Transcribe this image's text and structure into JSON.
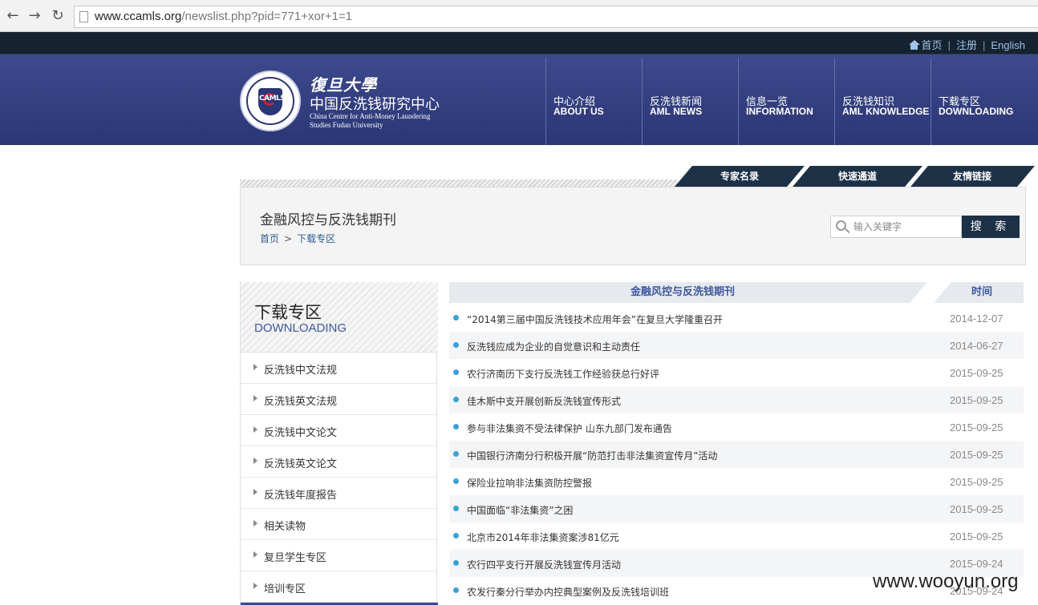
{
  "browser": {
    "url_host": "www.ccamls.org",
    "url_path": "/newslist.php?pid=771+xor+1=1"
  },
  "top_links": {
    "home": "首页",
    "register": "注册",
    "english": "English"
  },
  "brand": {
    "logo_text": "CAMLS",
    "script_title": "復旦大學",
    "name_cn": "中国反洗钱研究中心",
    "name_en_line1": "China Centre for Anti-Money Laundering",
    "name_en_line2": "Studies Fudan University"
  },
  "nav": [
    {
      "cn": "中心介绍",
      "en": "ABOUT US"
    },
    {
      "cn": "反洗钱新闻",
      "en": "AML NEWS"
    },
    {
      "cn": "信息一览",
      "en": "INFORMATION"
    },
    {
      "cn": "反洗钱知识",
      "en": "AML KNOWLEDGE"
    },
    {
      "cn": "下载专区",
      "en": "DOWNLOADING"
    }
  ],
  "tabs": [
    "专家名录",
    "快速通道",
    "友情链接"
  ],
  "page": {
    "title": "金融风控与反洗钱期刊",
    "crumb_home": "首页",
    "crumb_sep": ">",
    "crumb_current": "下载专区"
  },
  "search": {
    "placeholder": "输入关键字",
    "button": "搜 索"
  },
  "sidebar": {
    "title_cn": "下载专区",
    "title_en": "DOWNLOADING",
    "items": [
      "反洗钱中文法规",
      "反洗钱英文法规",
      "反洗钱中文论文",
      "反洗钱英文论文",
      "反洗钱年度报告",
      "相关读物",
      "复旦学生专区",
      "培训专区"
    ]
  },
  "list": {
    "col_title": "金融风控与反洗钱期刊",
    "col_time": "时间",
    "rows": [
      {
        "title": "“2014第三届中国反洗钱技术应用年会”在复旦大学隆重召开",
        "date": "2014-12-07"
      },
      {
        "title": "反洗钱应成为企业的自觉意识和主动责任",
        "date": "2014-06-27"
      },
      {
        "title": "农行济南历下支行反洗钱工作经验获总行好评",
        "date": "2015-09-25"
      },
      {
        "title": "佳木斯中支开展创新反洗钱宣传形式",
        "date": "2015-09-25"
      },
      {
        "title": "参与非法集资不受法律保护 山东九部门发布通告",
        "date": "2015-09-25"
      },
      {
        "title": "中国银行济南分行积极开展“防范打击非法集资宣传月”活动",
        "date": "2015-09-25"
      },
      {
        "title": "保险业拉响非法集资防控警报",
        "date": "2015-09-25"
      },
      {
        "title": "中国面临“非法集资”之困",
        "date": "2015-09-25"
      },
      {
        "title": "北京市2014年非法集资案涉81亿元",
        "date": "2015-09-25"
      },
      {
        "title": "农行四平支行开展反洗钱宣传月活动",
        "date": "2015-09-24"
      },
      {
        "title": "农发行秦分行举办内控典型案例及反洗钱培训班",
        "date": "2015-09-24"
      }
    ]
  },
  "watermark": "www.wooyun.org",
  "colors": {
    "header_top": "#3d4a8c",
    "header_bottom": "#2b3675",
    "dark_strip": "#152230",
    "tab_dark": "#1d3147",
    "accent_blue": "#3d57a0",
    "bullet": "#3aa0d8"
  }
}
